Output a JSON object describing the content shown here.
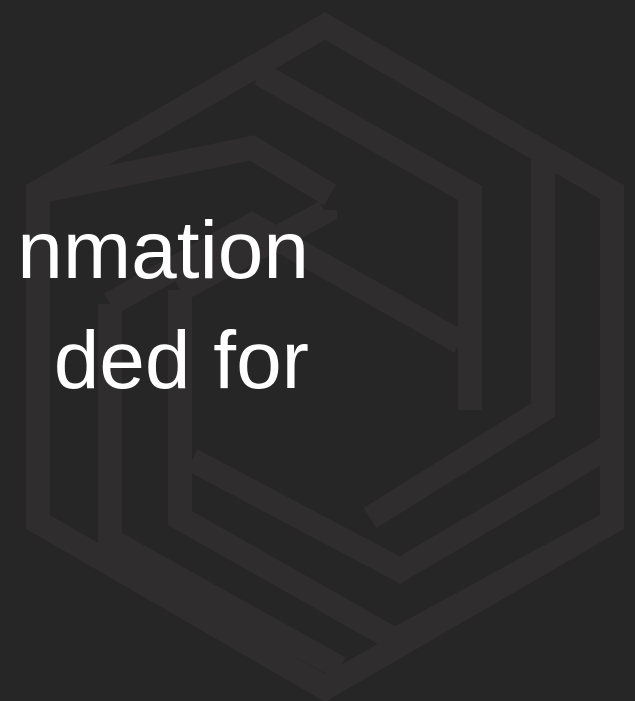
{
  "headline": {
    "line1": "nmation",
    "line2": "ded for"
  },
  "background": {
    "color": "#262626",
    "watermark": "hexagon-logo-watermark",
    "watermark_color": "#2f2d2e"
  },
  "text_color": "#ffffff"
}
